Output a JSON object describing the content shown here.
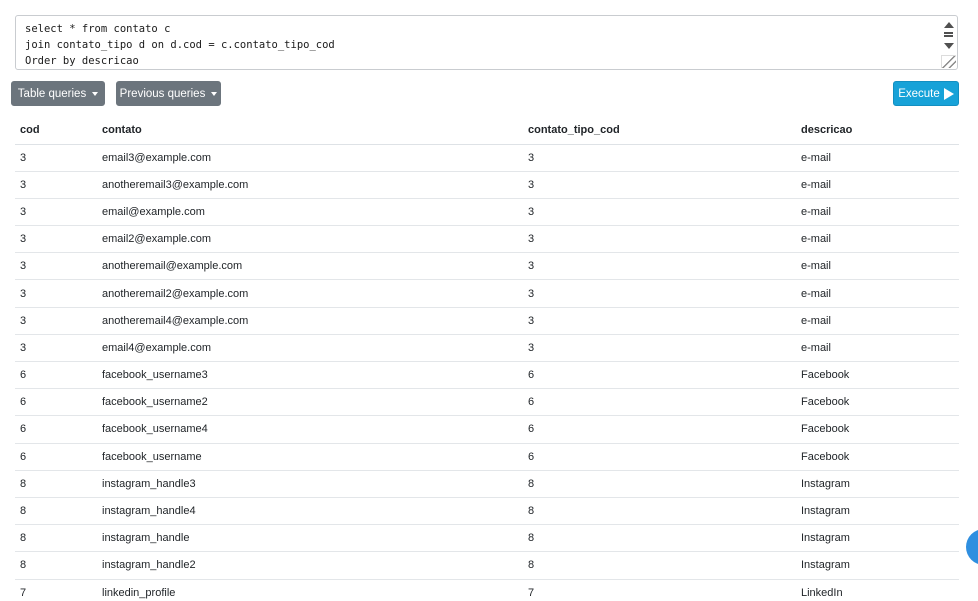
{
  "editor": {
    "query_lines": [
      "select * from contato c",
      "join contato_tipo d on d.cod = c.contato_tipo_cod",
      "Order by descricao"
    ]
  },
  "toolbar": {
    "table_queries_label": "Table queries",
    "previous_queries_label": "Previous queries",
    "execute_label": "Execute"
  },
  "table": {
    "headers": [
      "cod",
      "contato",
      "contato_tipo_cod",
      "descricao"
    ],
    "rows": [
      [
        "3",
        "email3@example.com",
        "3",
        "e-mail"
      ],
      [
        "3",
        "anotheremail3@example.com",
        "3",
        "e-mail"
      ],
      [
        "3",
        "email@example.com",
        "3",
        "e-mail"
      ],
      [
        "3",
        "email2@example.com",
        "3",
        "e-mail"
      ],
      [
        "3",
        "anotheremail@example.com",
        "3",
        "e-mail"
      ],
      [
        "3",
        "anotheremail2@example.com",
        "3",
        "e-mail"
      ],
      [
        "3",
        "anotheremail4@example.com",
        "3",
        "e-mail"
      ],
      [
        "3",
        "email4@example.com",
        "3",
        "e-mail"
      ],
      [
        "6",
        "facebook_username3",
        "6",
        "Facebook"
      ],
      [
        "6",
        "facebook_username2",
        "6",
        "Facebook"
      ],
      [
        "6",
        "facebook_username4",
        "6",
        "Facebook"
      ],
      [
        "6",
        "facebook_username",
        "6",
        "Facebook"
      ],
      [
        "8",
        "instagram_handle3",
        "8",
        "Instagram"
      ],
      [
        "8",
        "instagram_handle4",
        "8",
        "Instagram"
      ],
      [
        "8",
        "instagram_handle",
        "8",
        "Instagram"
      ],
      [
        "8",
        "instagram_handle2",
        "8",
        "Instagram"
      ],
      [
        "7",
        "linkedin_profile",
        "7",
        "LinkedIn"
      ]
    ]
  },
  "icons": {
    "caret": "caret-down-icon",
    "execute": "play-icon",
    "scroll_up": "arrow-up-icon",
    "scroll_down": "arrow-down-icon",
    "resize": "resize-grip-icon"
  },
  "colors": {
    "secondary_button": "#6c757d",
    "primary_button": "#17a2d8"
  }
}
